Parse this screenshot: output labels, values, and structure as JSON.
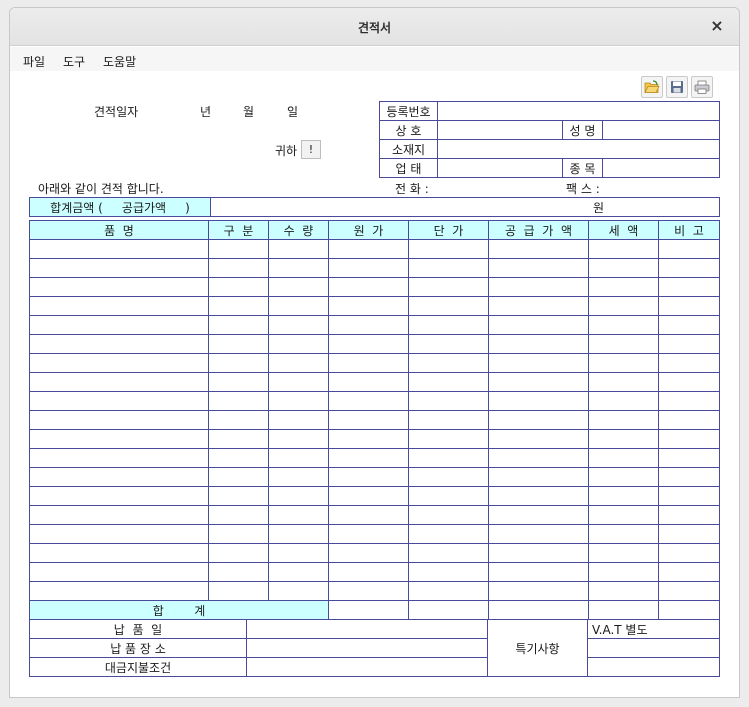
{
  "window": {
    "title": "견적서",
    "close_symbol": "×"
  },
  "menu": [
    "파일",
    "도구",
    "도움말"
  ],
  "toolbar": {
    "icons": [
      "open-folder-icon",
      "save-icon",
      "print-icon"
    ]
  },
  "header": {
    "date_label": "견적일자",
    "year": "년",
    "month": "월",
    "day": "일",
    "recipient_suffix": "귀하",
    "recipient_button": "!",
    "statement": "아래와 같이 견적 합니다.",
    "phone_label": "전 화 :",
    "fax_label": "팩 스 :"
  },
  "supplier": {
    "reg_no": "등록번호",
    "company": "상  호",
    "name": "성 명",
    "address": "소재지",
    "business": "업  태",
    "item": "종 목"
  },
  "total_amount": {
    "label": "합계금액 (     공급가액     )",
    "unit": "원"
  },
  "items_table": {
    "headers": [
      "품  명",
      "구  분",
      "수  량",
      "원  가",
      "단  가",
      "공  급  가  액",
      "세  액",
      "비  고"
    ],
    "empty_rows": 19,
    "total_label": "합        계"
  },
  "footer": {
    "delivery_date": "납  품  일",
    "delivery_place": "납 품 장 소",
    "payment_terms": "대금지불조건",
    "remarks": "특기사항",
    "vat": "V.A.T 별도"
  }
}
